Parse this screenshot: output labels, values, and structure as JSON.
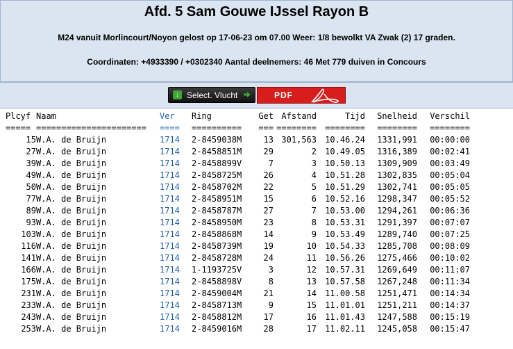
{
  "header": {
    "title": "Afd. 5 Sam Gouwe IJssel Rayon B",
    "line1": "M24 vanuit Morlincourt/Noyon gelost op 17-06-23 om 07.00 Weer: 1/8 bewolkt VA Zwak (2) 17 graden.",
    "line2": "Coordinaten: +4933390 / +0302340 Aantal deelnemers: 46 Met 779 duiven in Concours"
  },
  "toolbar": {
    "select_label": "Select. Vlucht",
    "pdf_label": "PDF"
  },
  "table": {
    "columns": [
      "Plcyf",
      "Naam",
      "Ver",
      "Ring",
      "Get",
      "Afstand",
      "Tijd",
      "Snelheid",
      "Verschil"
    ],
    "separators": [
      "=====",
      "======================",
      "====",
      "==========",
      "===",
      "========",
      "========",
      "========",
      "========"
    ],
    "rows": [
      [
        "15",
        "W.A. de Bruijn",
        "1714",
        "2-8459038M",
        "13",
        "301,563",
        "10.46.24",
        "1331,991",
        "00:00:00"
      ],
      [
        "27",
        "W.A. de Bruijn",
        "1714",
        "2-8458851M",
        "29",
        "2",
        "10.49.05",
        "1316,389",
        "00:02:41"
      ],
      [
        "39",
        "W.A. de Bruijn",
        "1714",
        "2-8458899V",
        "7",
        "3",
        "10.50.13",
        "1309,909",
        "00:03:49"
      ],
      [
        "49",
        "W.A. de Bruijn",
        "1714",
        "2-8458725M",
        "26",
        "4",
        "10.51.28",
        "1302,835",
        "00:05:04"
      ],
      [
        "50",
        "W.A. de Bruijn",
        "1714",
        "2-8458702M",
        "22",
        "5",
        "10.51.29",
        "1302,741",
        "00:05:05"
      ],
      [
        "77",
        "W.A. de Bruijn",
        "1714",
        "2-8458951M",
        "15",
        "6",
        "10.52.16",
        "1298,347",
        "00:05:52"
      ],
      [
        "89",
        "W.A. de Bruijn",
        "1714",
        "2-8458787M",
        "27",
        "7",
        "10.53.00",
        "1294,261",
        "00:06:36"
      ],
      [
        "93",
        "W.A. de Bruijn",
        "1714",
        "2-8458950M",
        "23",
        "8",
        "10.53.31",
        "1291,397",
        "00:07:07"
      ],
      [
        "103",
        "W.A. de Bruijn",
        "1714",
        "2-8458868M",
        "14",
        "9",
        "10.53.49",
        "1289,740",
        "00:07:25"
      ],
      [
        "116",
        "W.A. de Bruijn",
        "1714",
        "2-8458739M",
        "19",
        "10",
        "10.54.33",
        "1285,708",
        "00:08:09"
      ],
      [
        "141",
        "W.A. de Bruijn",
        "1714",
        "2-8458728M",
        "24",
        "11",
        "10.56.26",
        "1275,466",
        "00:10:02"
      ],
      [
        "166",
        "W.A. de Bruijn",
        "1714",
        "1-1193725V",
        "3",
        "12",
        "10.57.31",
        "1269,649",
        "00:11:07"
      ],
      [
        "175",
        "W.A. de Bruijn",
        "1714",
        "2-8458898V",
        "8",
        "13",
        "10.57.58",
        "1267,248",
        "00:11:34"
      ],
      [
        "231",
        "W.A. de Bruijn",
        "1714",
        "2-8459004M",
        "21",
        "14",
        "11.00.58",
        "1251,471",
        "00:14:34"
      ],
      [
        "233",
        "W.A. de Bruijn",
        "1714",
        "2-8458713M",
        "9",
        "15",
        "11.01.01",
        "1251,211",
        "00:14:37"
      ],
      [
        "243",
        "W.A. de Bruijn",
        "1714",
        "2-8458812M",
        "17",
        "16",
        "11.01.43",
        "1247,588",
        "00:15:19"
      ],
      [
        "253",
        "W.A. de Bruijn",
        "1714",
        "2-8459016M",
        "28",
        "17",
        "11.02.11",
        "1245,058",
        "00:15:47"
      ]
    ]
  },
  "colors": {
    "header_bg": "#dbe5f1",
    "link_blue": "#1f5fa8",
    "pdf_red": "#d81d1d"
  },
  "icons": {
    "select": "download-arrow-icon",
    "next": "arrow-right-icon",
    "pdf": "adobe-acrobat-icon"
  }
}
